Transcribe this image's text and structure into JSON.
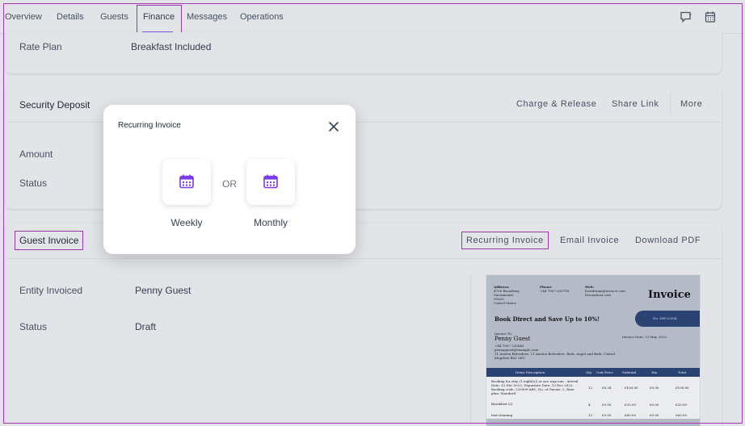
{
  "tabs": [
    "Overview",
    "Details",
    "Guests",
    "Finance",
    "Messages",
    "Operations"
  ],
  "active_tab": "Finance",
  "header_icons": [
    "chat-icon",
    "calendar-icon"
  ],
  "rate_plan": {
    "label": "Rate Plan",
    "value": "Breakfast Included"
  },
  "security_deposit": {
    "title": "Security Deposit",
    "actions": [
      "Charge & Release",
      "Share Link",
      "More"
    ],
    "fields": [
      {
        "label": "Amount",
        "value": ""
      },
      {
        "label": "Status",
        "value": ""
      }
    ]
  },
  "guest_invoice": {
    "title": "Guest Invoice",
    "actions": [
      "Recurring Invoice",
      "Email Invoice",
      "Download PDF"
    ],
    "fields": [
      {
        "label": "Entity Invoiced",
        "value": "Penny Guest"
      },
      {
        "label": "Status",
        "value": "Draft"
      }
    ]
  },
  "modal": {
    "title": "Recurring Invoice",
    "or_text": "OR",
    "options": [
      {
        "label": "Weekly",
        "icon": "calendar-icon"
      },
      {
        "label": "Monthly",
        "icon": "calendar-icon"
      }
    ]
  },
  "invoice_preview": {
    "address_label": "Address:",
    "address_lines": [
      "4700 Broadway",
      "Sacramento",
      "95820",
      "United States"
    ],
    "phone_label": "Phone:",
    "phone": "+44 7907 020716",
    "web_label": "Web:",
    "web_lines": [
      "hostdream@invoice.com",
      "Dreamhost.com"
    ],
    "title": "Invoice",
    "number": "No. DW-22004",
    "promo": "Book Direct and Save Up to 10%!",
    "invoice_to": "Invoice To:",
    "guest_name": "Penny Guest",
    "contact_lines": [
      "+44 7907 220640",
      "pennyguest@example.com",
      "11 Austen Belvedere, 11 Austen Belvedere, Bath, Angel and Bath, United Kingdom BA1 2EU"
    ],
    "invoice_date_label": "Invoice Date:",
    "invoice_date": "23 May 2023",
    "columns": [
      "Items Description",
      "Qty",
      "Unit Price",
      "Subtotal",
      "Tax",
      "Total"
    ],
    "rows": [
      {
        "desc": "Booking for stay (1 night(s)) at one way.com - Arrival Date: 12 Dec 2023, Departure Date: 13 Dec 2023. Booking code: 220909-ABC, No. of Guests: 2, Rate plan: Standard",
        "qty": "12",
        "unit": "£8.34",
        "subtotal": "£100.00",
        "tax": "£0.00",
        "total": "£100.00"
      },
      {
        "desc": "Breakfast (2)",
        "qty": "4",
        "unit": "£5.00",
        "subtotal": "£20.00",
        "tax": "£0.00",
        "total": "£20.00"
      },
      {
        "desc": "test-cleaning",
        "qty": "12",
        "unit": "£5.00",
        "subtotal": "£60.00",
        "tax": "£0.00",
        "total": "£60.00"
      }
    ]
  },
  "colors": {
    "accent": "#8b5cf6",
    "highlight_border": "#a33ab3",
    "invoice_navy": "#2d4677"
  }
}
